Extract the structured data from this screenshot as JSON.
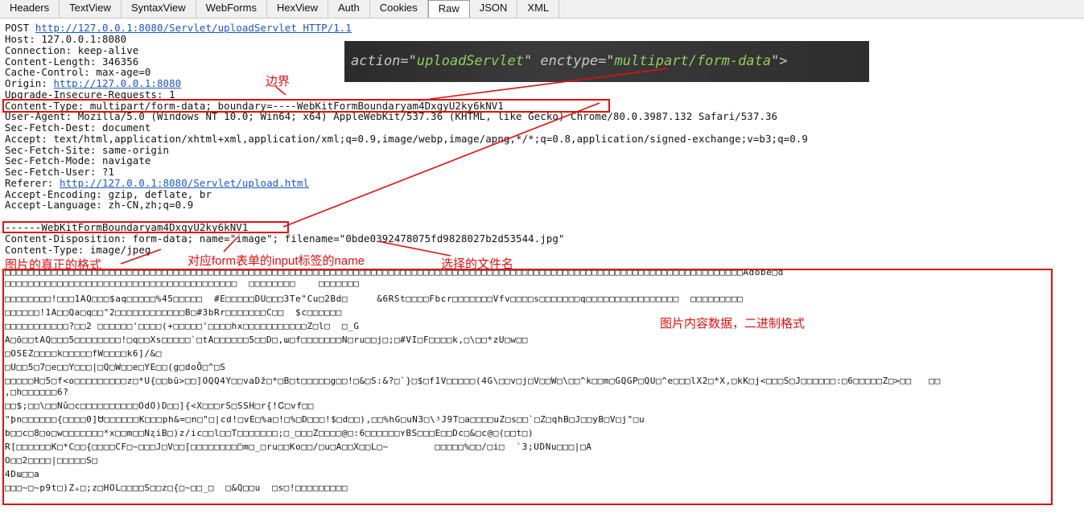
{
  "tabs": [
    "Headers",
    "TextView",
    "SyntaxView",
    "WebForms",
    "HexView",
    "Auth",
    "Cookies",
    "Raw",
    "JSON",
    "XML"
  ],
  "active_tab": "Raw",
  "request": {
    "method": "POST",
    "url": "http://127.0.0.1:8080/Servlet/uploadServlet",
    "protocol": "HTTP/1.1",
    "host": "Host: 127.0.0.1:8080",
    "connection": "Connection: keep-alive",
    "content_length": "Content-Length: 346356",
    "cache_control": "Cache-Control: max-age=0",
    "origin_label": "Origin: ",
    "origin_url": "http://127.0.0.1:8080",
    "upgrade": "Upgrade-Insecure-Requests: 1",
    "content_type": "Content-Type: multipart/form-data; boundary=----WebKitFormBoundaryam4DxgyU2ky6kNV1",
    "user_agent": "User-Agent: Mozilla/5.0 (Windows NT 10.0; Win64; x64) AppleWebKit/537.36 (KHTML, like Gecko) Chrome/80.0.3987.132 Safari/537.36",
    "sec_fetch_dest": "Sec-Fetch-Dest: document",
    "accept": "Accept: text/html,application/xhtml+xml,application/xml;q=0.9,image/webp,image/apng,*/*;q=0.8,application/signed-exchange;v=b3;q=0.9",
    "sec_fetch_site": "Sec-Fetch-Site: same-origin",
    "sec_fetch_mode": "Sec-Fetch-Mode: navigate",
    "sec_fetch_user": "Sec-Fetch-User: ?1",
    "referer_label": "Referer: ",
    "referer_url": "http://127.0.0.1:8080/Servlet/upload.html",
    "accept_encoding": "Accept-Encoding: gzip, deflate, br",
    "accept_language": "Accept-Language: zh-CN,zh;q=0.9"
  },
  "body": {
    "boundary": "------WebKitFormBoundaryam4DxgyU2ky6kNV1",
    "content_disposition": "Content-Disposition: form-data; name=\"image\"; filename=\"0bde0392478075fd9828027b2d53544.jpg\"",
    "content_type": "Content-Type: image/jpeg",
    "binary_lines": [
      "□□□□□□□□□□□□□□□□□□□□□□□□□□□□□□□□□□□□□□□□□□□□□□□□□□□□□□□□□□□□□□□□□□□□□□□□□□□□□□□□□□□□□□□□□□□□□□□□□□□□□□□□□□□□□□□□□□□□□□□□□□□□□□□Adobe□d",
      "□□□□□□□□□□□□□□□□□□□□□□□□□□□□□□□□□□□□□□□□  □□□□□□□□    □□□□□□□",
      "",
      "□□□□□□□□!□□□1AQ□□□$aq□□□□□%45□□□□□  #E□□□□□DU□□□3Te\"Cu□2Bd□     &6RSt□□□□Fbcr□□□□□□□Vfv□□□□s□□□□□□□q□□□□□□□□□□□□□□□□  □□□□□□□□□",
      "□□□□□□!1A□□Qa□q□□\"2□□□□□□□□□□□□B□#3bRr□□□□□□□C□□  $c□□□□□□",
      "□□□□□□□□□□□?□□2 □□□□□□'□□□□(+□□□□□'□□□□hx□□□□□□□□□□□Z□l□  □_G",
      "A□ō□□tAQ□□□5□□□□□□□□!□q□□Xs□□□□□`□tA□□□□□□5□□D□,ɯ□f□□□□□□□N□ru□□j□;□#VI□F□□□□k,□\\□□*zU□w□□",
      "□OSEZ□□□□k□□□□□fW□□□□k6]/&□",
      "□U□□5□7□e□□Y□□□|□Q□W□□e□YE□□(g□doŌ□^□S",
      "□□□□□H□5□f<o□□□□□□□□□z□*U{□□bū>□□]OQQ4Y□□vaDž□*□B□t□□□□□g□□!□&□S:&?□`}□$□f1V□□□□□(4G\\□□v□j□V□□W□\\□□^k□□m□GQGP□QU□^e□□□lX2□*X,□kK□j<□□□S□J□□□□□□:□6□□□□□Z□>□□   □□",
      ",□h□□□□□□6?",
      "□□$;□□\\□□Nǔ□c□□□□□□□□□□OdO)D□□]{<X□□□rS□SSH□r{!Ꮯ□vf□□",
      "\"þn□□□□□□{□□□□0]Ꮜ□□□□□□K□□□ph&=□n□\"□|cd!□vE□%a□!□%□D□□□!$□d□□),□□%hG□uN3□\\ᶾJ9T□a□□□□uZ□s□□`□Z□qhB□J□□yB□V□j\"□u",
      "b□□c□8□o□w□□□□□□□*x□□m□□Nʐi̇B□)z/ic□□l□□T□□□□□□□;□_□□□Z□□□□@□:6□□□□□□ʏBS□□□E□□Dc□&□c@□(□□t□)",
      "R[□□□□□□K□*C□□{□□□□CF□~□□□J□V□□[□□□□□□□□̈□m□_□ru□□Ko□□/□u□A□□X□□L□~        □□□□□%□□/□i□  `3;UDNu□□□|□A",
      "O□□2□□□□|□□□□□S□",
      "4Dɯ□□a",
      "□□□~□~p9t□)Zₑ□;z□HOL□□□□S□□z□{□~□□_□  □&Q□□u  □s□!□□□□□□□□□"
    ]
  },
  "overlay": {
    "prefix": "action=\"",
    "action_value": "uploadServlet",
    "middle": "\" enctype=\"",
    "enctype_value": "multipart/form-data",
    "suffix": "\">",
    "attr_color": "#c9c9c9",
    "value_color": "#8fd05a"
  },
  "annotations": {
    "boundary": "边界",
    "image_format": "图片的真正的格式",
    "form_name": "对应form表单的input标签的name",
    "filename": "选择的文件名",
    "binary": "图片内容数据，二进制格式"
  },
  "colors": {
    "annotation": "#e01010",
    "link": "#1a56c8"
  }
}
